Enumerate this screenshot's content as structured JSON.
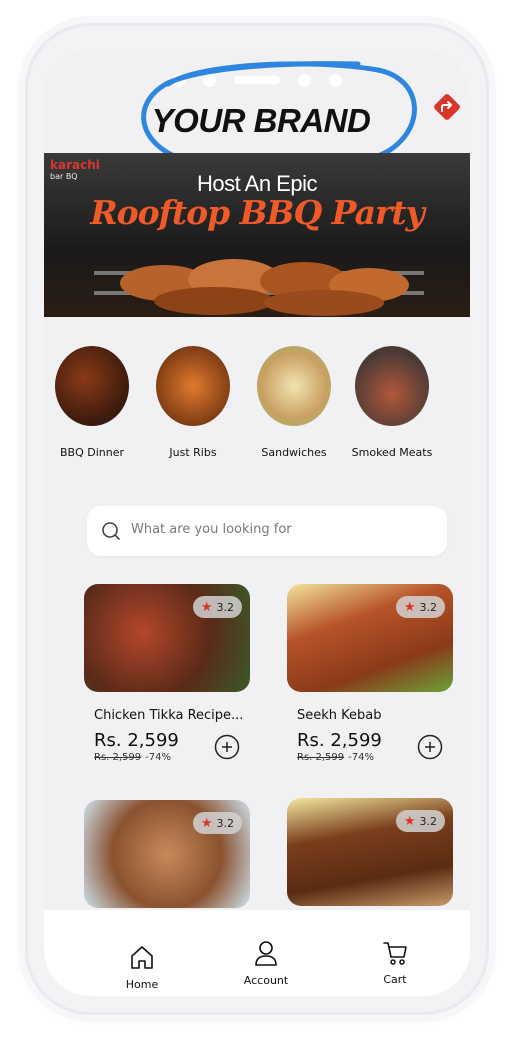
{
  "brand": {
    "title": "YOUR BRAND"
  },
  "banner": {
    "logo_main": "karachi",
    "logo_sub": "bar BQ",
    "headline": "Host An Epic",
    "subheadline": "Rooftop BBQ Party"
  },
  "categories": [
    {
      "label": "BBQ Dinner",
      "icon": "bbq-dinner-image"
    },
    {
      "label": "Just Ribs",
      "icon": "ribs-image"
    },
    {
      "label": "Sandwiches",
      "icon": "sandwich-image"
    },
    {
      "label": "Smoked Meats",
      "icon": "smoked-meat-image"
    }
  ],
  "search": {
    "placeholder": "What are you looking for"
  },
  "products": [
    {
      "name": "Chicken Tikka Recipe...",
      "rating": "3.2",
      "price": "Rs. 2,599",
      "old_price": "Rs. 2,599",
      "discount": "-74%"
    },
    {
      "name": "Seekh Kebab",
      "rating": "3.2",
      "price": "Rs. 2,599",
      "old_price": "Rs. 2,599",
      "discount": "-74%"
    },
    {
      "rating": "3.2"
    },
    {
      "rating": "3.2"
    }
  ],
  "tabs": [
    {
      "label": "Home",
      "icon": "home-icon"
    },
    {
      "label": "Account",
      "icon": "account-icon"
    },
    {
      "label": "Cart",
      "icon": "cart-icon"
    }
  ],
  "colors": {
    "accent": "#d9362b",
    "circle": "#2f86e0",
    "party": "#f05a28"
  }
}
